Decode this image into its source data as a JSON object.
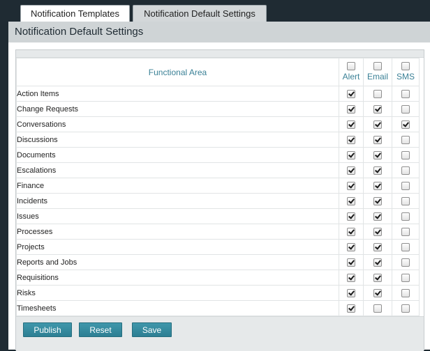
{
  "tabs": [
    {
      "label": "Notification Templates",
      "active": false
    },
    {
      "label": "Notification Default Settings",
      "active": true
    }
  ],
  "panel": {
    "title": "Notification Default Settings"
  },
  "table": {
    "columns": {
      "area": "Functional Area",
      "alert": "Alert",
      "email": "Email",
      "sms": "SMS"
    },
    "header_checks": {
      "alert": false,
      "email": false,
      "sms": false
    },
    "rows": [
      {
        "name": "Action Items",
        "alert": true,
        "email": false,
        "sms": false
      },
      {
        "name": "Change Requests",
        "alert": true,
        "email": true,
        "sms": false
      },
      {
        "name": "Conversations",
        "alert": true,
        "email": true,
        "sms": true
      },
      {
        "name": "Discussions",
        "alert": true,
        "email": true,
        "sms": false
      },
      {
        "name": "Documents",
        "alert": true,
        "email": true,
        "sms": false
      },
      {
        "name": "Escalations",
        "alert": true,
        "email": true,
        "sms": false
      },
      {
        "name": "Finance",
        "alert": true,
        "email": true,
        "sms": false
      },
      {
        "name": "Incidents",
        "alert": true,
        "email": true,
        "sms": false
      },
      {
        "name": "Issues",
        "alert": true,
        "email": true,
        "sms": false
      },
      {
        "name": "Processes",
        "alert": true,
        "email": true,
        "sms": false
      },
      {
        "name": "Projects",
        "alert": true,
        "email": true,
        "sms": false
      },
      {
        "name": "Reports and Jobs",
        "alert": true,
        "email": true,
        "sms": false
      },
      {
        "name": "Requisitions",
        "alert": true,
        "email": true,
        "sms": false
      },
      {
        "name": "Risks",
        "alert": true,
        "email": true,
        "sms": false
      },
      {
        "name": "Timesheets",
        "alert": true,
        "email": false,
        "sms": false
      }
    ]
  },
  "buttons": {
    "publish": "Publish",
    "reset": "Reset",
    "save": "Save"
  },
  "colors": {
    "page_background": "#1f2b33",
    "accent": "#3a8096",
    "button": "#3490a5",
    "panel_header": "#cfd4d6"
  }
}
